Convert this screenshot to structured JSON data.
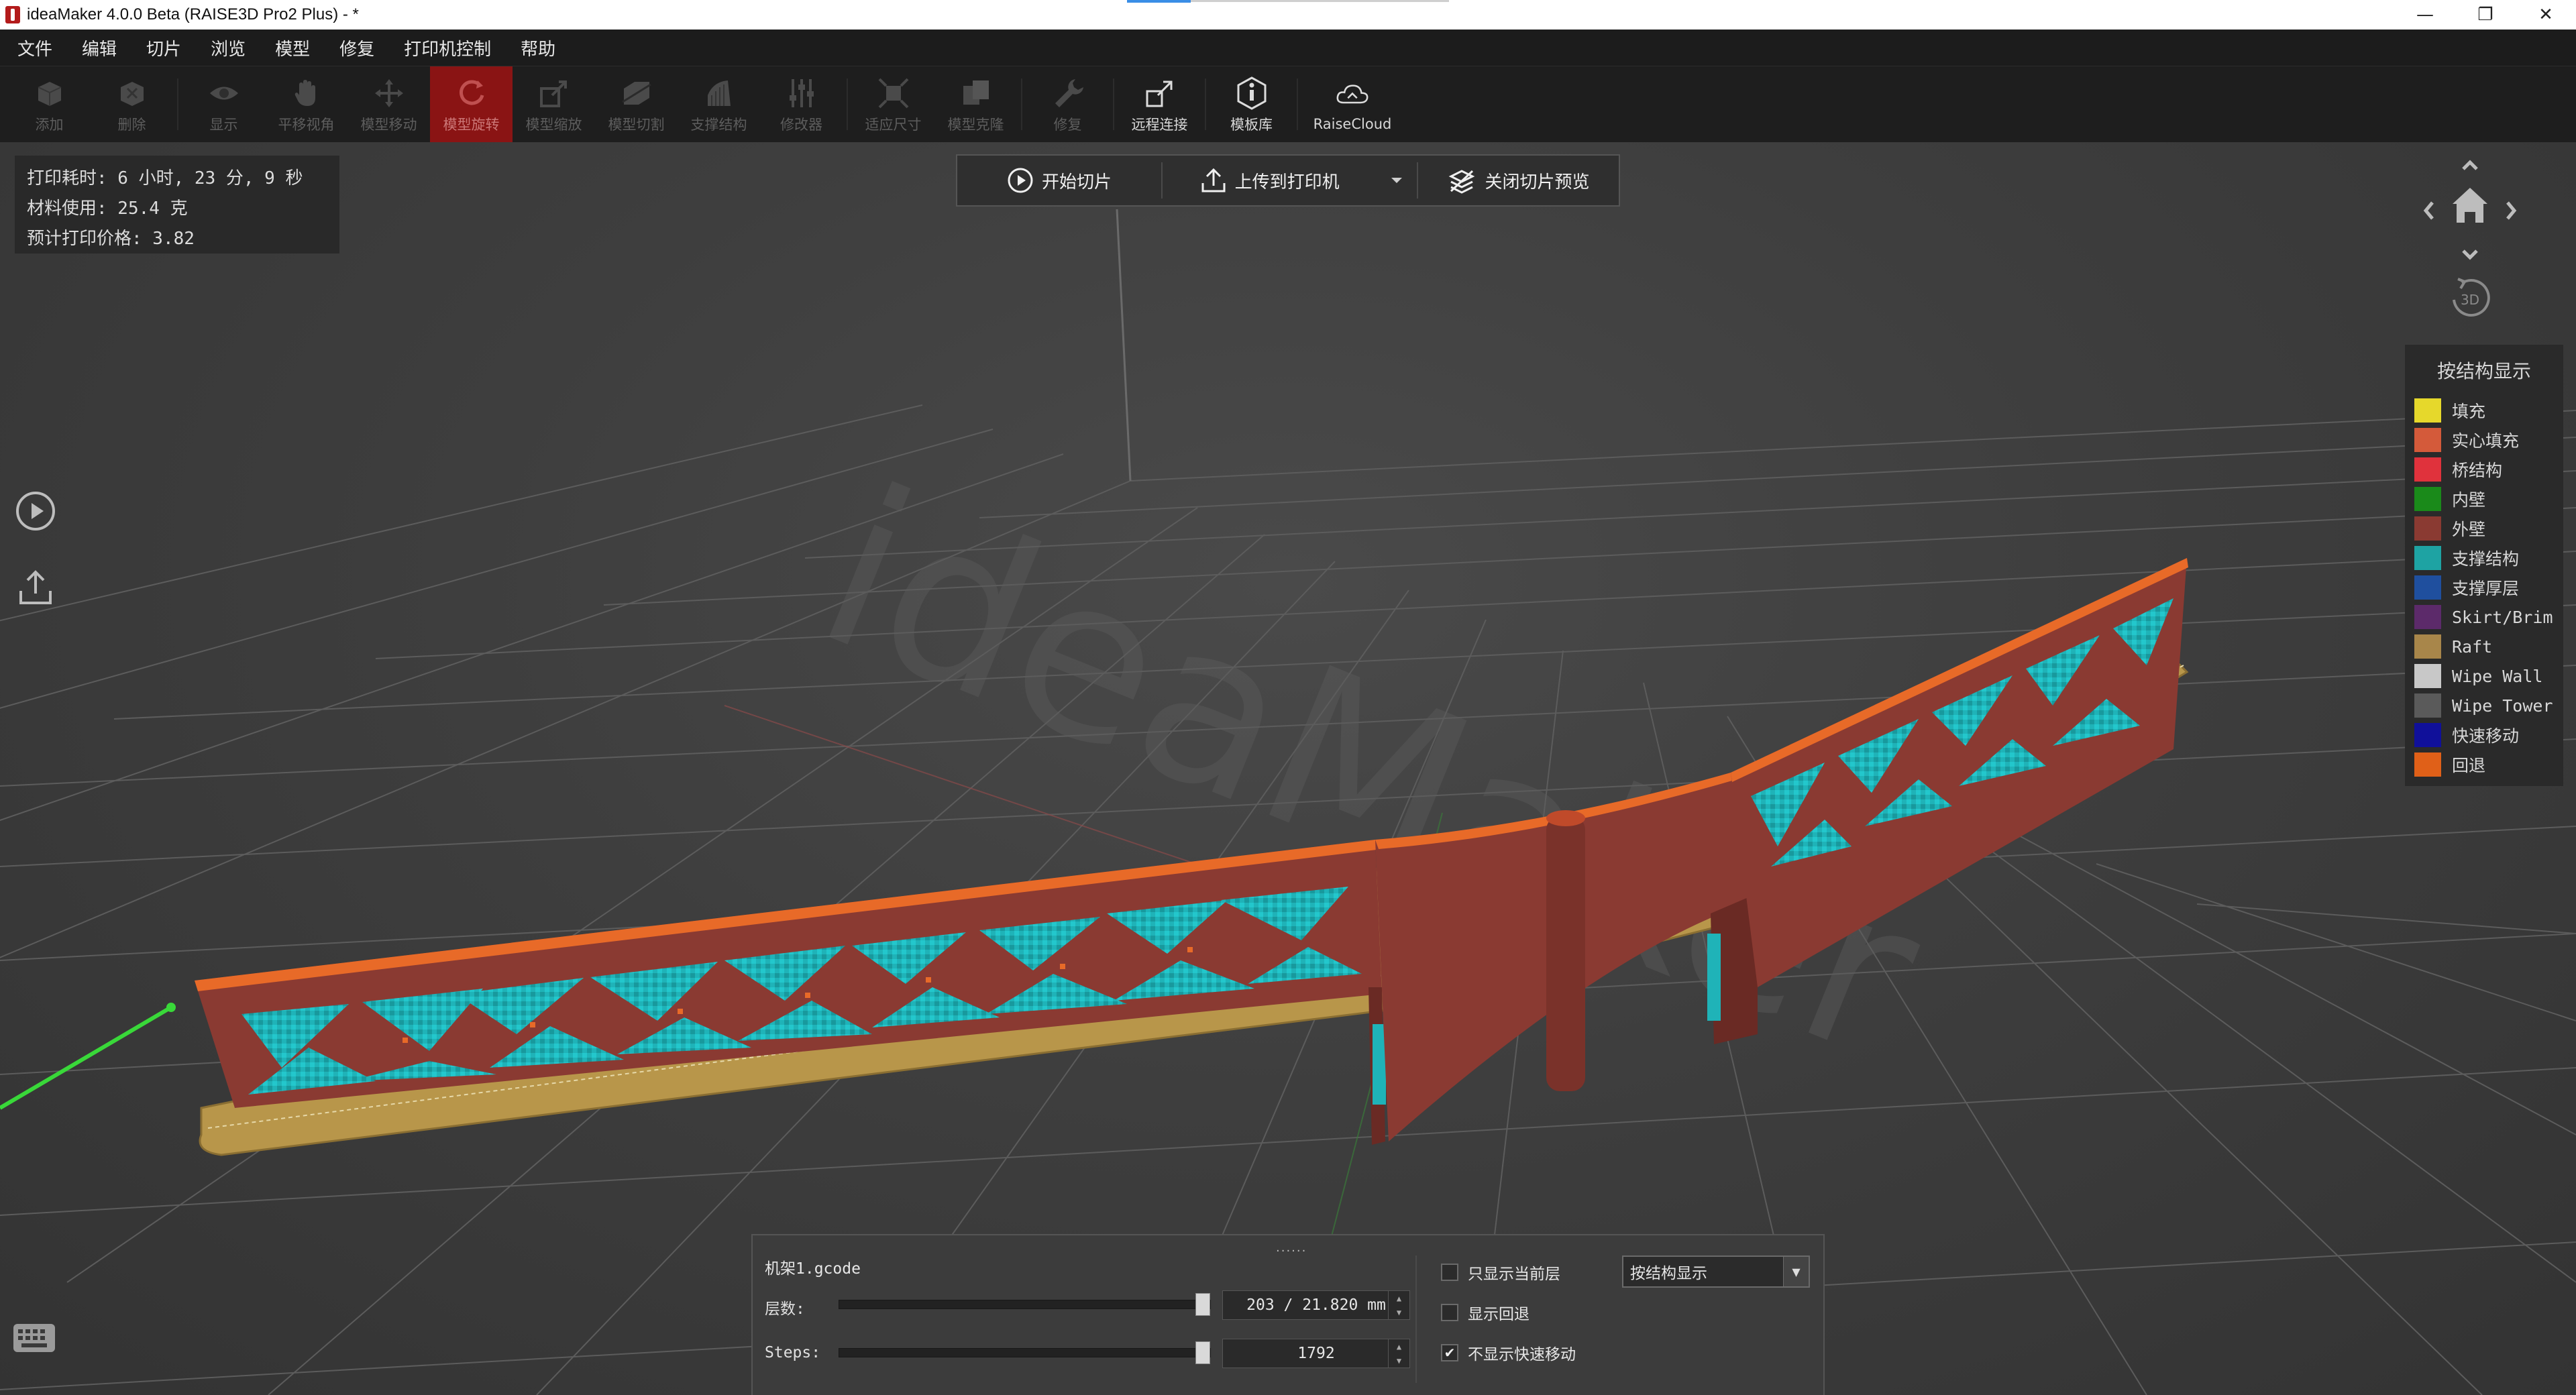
{
  "window": {
    "title": "ideaMaker 4.0.0 Beta (RAISE3D Pro2 Plus) - *",
    "minimize": "—",
    "maximize": "❐",
    "close": "✕"
  },
  "menu": {
    "items": [
      "文件",
      "编辑",
      "切片",
      "浏览",
      "模型",
      "修复",
      "打印机控制",
      "帮助"
    ]
  },
  "toolbar": {
    "tools": [
      {
        "label": "添加",
        "icon": "add-cube-icon"
      },
      {
        "label": "删除",
        "icon": "delete-cube-icon"
      },
      {
        "label": "显示",
        "icon": "eye-icon"
      },
      {
        "label": "平移视角",
        "icon": "hand-icon"
      },
      {
        "label": "模型移动",
        "icon": "move-arrows-icon"
      },
      {
        "label": "模型旋转",
        "icon": "rotate-icon"
      },
      {
        "label": "模型缩放",
        "icon": "scale-icon"
      },
      {
        "label": "模型切割",
        "icon": "cut-icon"
      },
      {
        "label": "支撑结构",
        "icon": "support-icon"
      },
      {
        "label": "修改器",
        "icon": "sliders-icon"
      },
      {
        "label": "适应尺寸",
        "icon": "fit-size-icon"
      },
      {
        "label": "模型克隆",
        "icon": "clone-icon"
      },
      {
        "label": "修复",
        "icon": "wrench-icon"
      },
      {
        "label": "远程连接",
        "icon": "remote-connect-icon"
      },
      {
        "label": "模板库",
        "icon": "template-library-icon"
      },
      {
        "label": "RaiseCloud",
        "icon": "cloud-icon"
      }
    ]
  },
  "info": {
    "print_time": "打印耗时: 6 小时, 23 分, 9 秒",
    "material": "材料使用: 25.4 克",
    "price": "预计打印价格: 3.82"
  },
  "actions": {
    "start_slice": "开始切片",
    "upload": "上传到打印机",
    "close_preview": "关闭切片预览"
  },
  "nav": {
    "view_3d": "3D"
  },
  "legend": {
    "title": "按结构显示",
    "items": [
      {
        "label": "填充",
        "color": "#e6d82b"
      },
      {
        "label": "实心填充",
        "color": "#d45a3a"
      },
      {
        "label": "桥结构",
        "color": "#e0323c"
      },
      {
        "label": "内壁",
        "color": "#1a8a1a"
      },
      {
        "label": "外壁",
        "color": "#8a3a32"
      },
      {
        "label": "支撑结构",
        "color": "#1ea3a3"
      },
      {
        "label": "支撑厚层",
        "color": "#1f4f9e"
      },
      {
        "label": "Skirt/Brim",
        "color": "#5c2a6a"
      },
      {
        "label": "Raft",
        "color": "#a8864a"
      },
      {
        "label": "Wipe Wall",
        "color": "#c8c8c8"
      },
      {
        "label": "Wipe Tower",
        "color": "#5a5a5a"
      },
      {
        "label": "快速移动",
        "color": "#10109a"
      },
      {
        "label": "回退",
        "color": "#e06018"
      }
    ]
  },
  "preview_panel": {
    "grip": "......",
    "file_name": "机架1.gcode",
    "layers_label": "层数:",
    "layers_value": "203 / 21.820 mm",
    "layers_position": 1.0,
    "steps_label": "Steps:",
    "steps_value": "1792",
    "steps_position": 1.0,
    "only_current_layer": {
      "label": "只显示当前层",
      "checked": false
    },
    "show_retraction": {
      "label": "显示回退",
      "checked": false
    },
    "hide_travel": {
      "label": "不显示快速移动",
      "checked": true,
      "mark": "✔"
    },
    "display_mode": "按结构显示"
  },
  "watermark": "ideaMaker",
  "colors": {
    "wall": "#8a3a32",
    "top_edge": "#e86a28",
    "support": "#1fb3b8",
    "raft": "#b8964a",
    "active_tool": "#8a1414"
  }
}
